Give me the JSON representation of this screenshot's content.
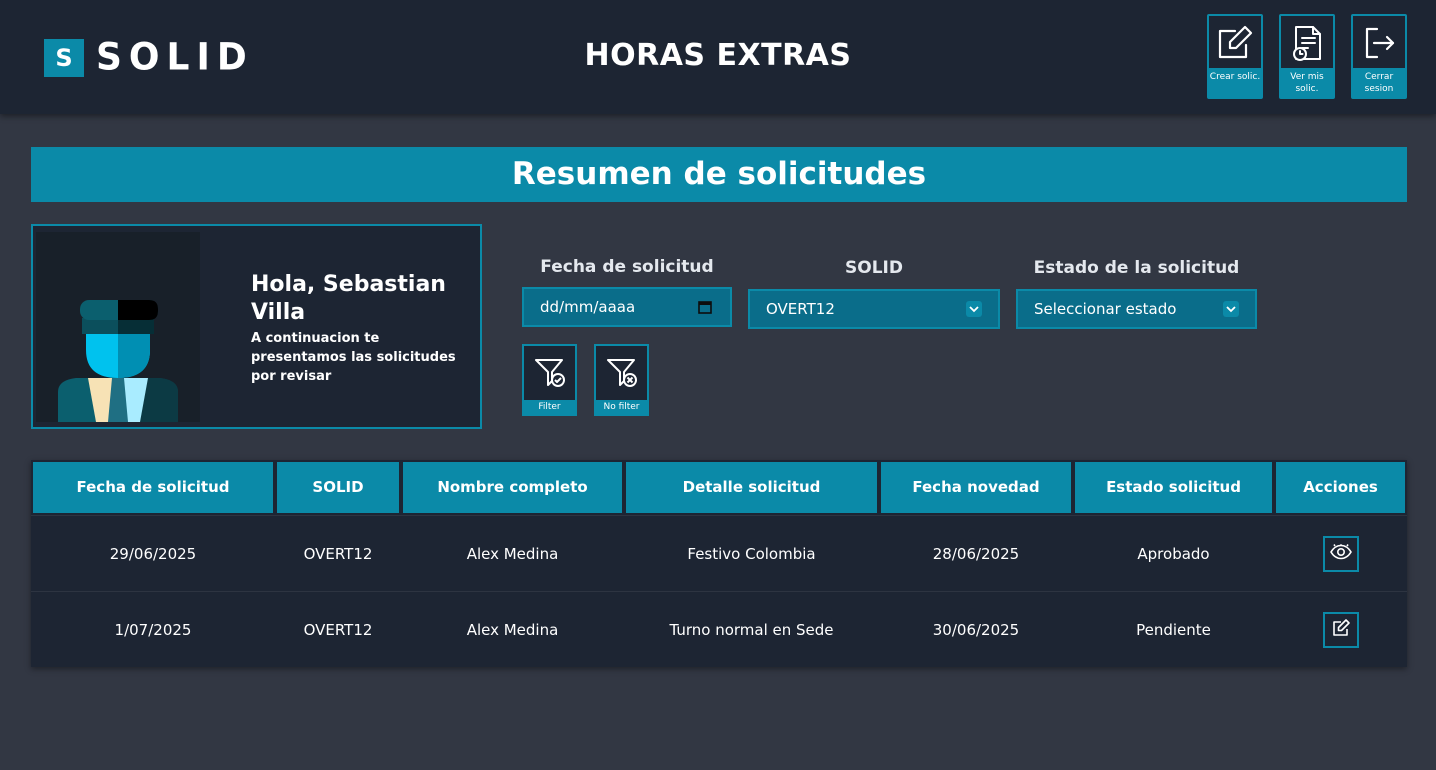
{
  "brand": {
    "badge": "S",
    "name": "SOLID"
  },
  "app_title": "HORAS EXTRAS",
  "nav": [
    {
      "label": "Crear solic.",
      "icon": "edit-icon"
    },
    {
      "label": "Ver mis solic.",
      "icon": "document-clock-icon"
    },
    {
      "label": "Cerrar sesion",
      "icon": "logout-icon"
    }
  ],
  "banner_title": "Resumen de solicitudes",
  "profile": {
    "greeting": "Hola, Sebastian Villa",
    "subtitle": "A continuacion te presentamos las solicitudes por revisar"
  },
  "filters": {
    "date_label": "Fecha de solicitud",
    "date_placeholder": "dd/mm/aaaa",
    "solid_label": "SOLID",
    "solid_value": "OVERT12",
    "status_label": "Estado de la solicitud",
    "status_value": "Seleccionar estado",
    "filter_btn": "Filter",
    "nofilter_btn": "No filter"
  },
  "table": {
    "headers": [
      "Fecha de solicitud",
      "SOLID",
      "Nombre completo",
      "Detalle solicitud",
      "Fecha novedad",
      "Estado solicitud",
      "Acciones"
    ],
    "rows": [
      {
        "fecha": "29/06/2025",
        "solid": "OVERT12",
        "nombre": "Alex Medina",
        "detalle": "Festivo Colombia",
        "novedad": "28/06/2025",
        "estado": "Aprobado",
        "action": "view-icon"
      },
      {
        "fecha": "1/07/2025",
        "solid": "OVERT12",
        "nombre": "Alex Medina",
        "detalle": "Turno normal en Sede",
        "novedad": "30/06/2025",
        "estado": "Pendiente",
        "action": "edit-icon"
      }
    ]
  },
  "colors": {
    "accent": "#0b8aa8",
    "bar": "#1d2533",
    "background": "#323743"
  }
}
